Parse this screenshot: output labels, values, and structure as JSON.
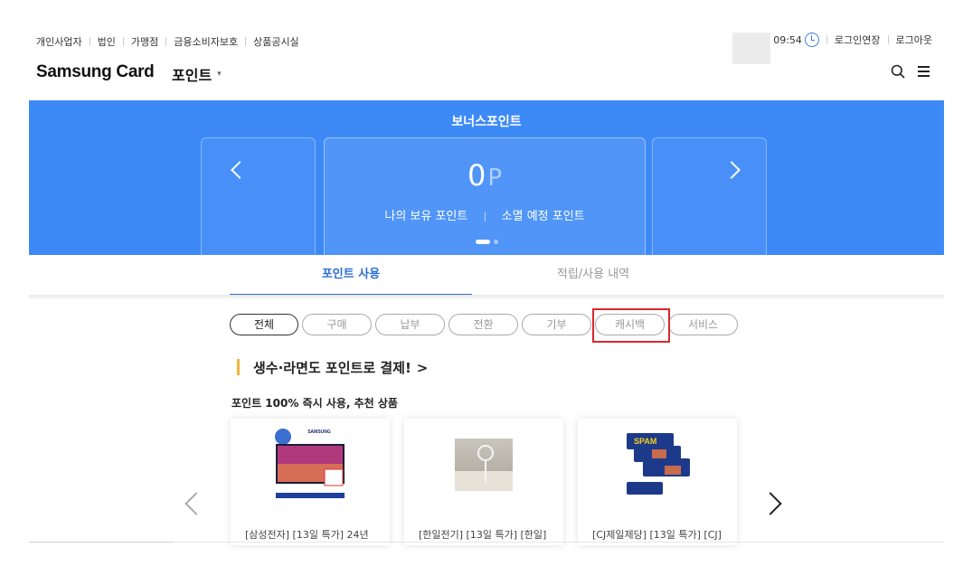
{
  "utility_nav": {
    "left": [
      "개인사업자",
      "법인",
      "가맹점",
      "금융소비자보호",
      "상품공시실"
    ],
    "time": "09:54",
    "extend_login": "로그인연장",
    "logout": "로그아웃"
  },
  "header": {
    "brand": "Samsung Card",
    "menu_title": "포인트",
    "caret": "▾"
  },
  "banner": {
    "title": "보너스포인트",
    "points_value": "0",
    "points_unit": "P",
    "my_points_link": "나의 보유 포인트",
    "expiring_points_link": "소멸 예정 포인트",
    "background_color": "#3d8af7"
  },
  "tabs": [
    {
      "label": "포인트 사용",
      "active": true
    },
    {
      "label": "적립/사용 내역",
      "active": false
    }
  ],
  "chips": [
    {
      "label": "전체",
      "active": true
    },
    {
      "label": "구매",
      "active": false
    },
    {
      "label": "납부",
      "active": false
    },
    {
      "label": "전환",
      "active": false
    },
    {
      "label": "기부",
      "active": false
    },
    {
      "label": "캐시백",
      "active": false
    },
    {
      "label": "서비스",
      "active": false
    }
  ],
  "promo": {
    "title": "생수·라면도 포인트로 결제!",
    "title_chevron": ">",
    "subtitle": "포인트 100% 즉시 사용, 추천 상품"
  },
  "products": [
    {
      "name": "[삼성전자] [13일 특가] 24년",
      "image": "tv-image",
      "image_brand": "SAMSUNG"
    },
    {
      "name": "[한일전기] [13일 특가] [한일]",
      "image": "fan-image"
    },
    {
      "name": "[CJ제일제당] [13일 특가] [CJ]",
      "image": "spam-image",
      "image_brand": "SPAM"
    }
  ],
  "colors": {
    "accent": "#2b6fd6",
    "highlight": "#d9272e",
    "promo_bar": "#f2b53b"
  }
}
